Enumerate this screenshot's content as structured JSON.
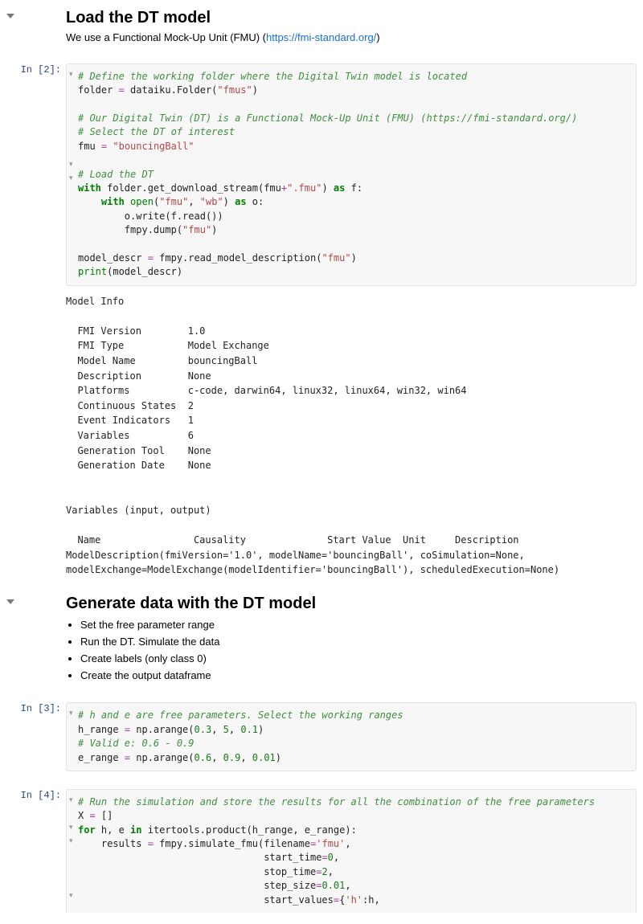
{
  "cells": {
    "md1": {
      "heading": "Load the DT model",
      "intro_pre": "We use a Functional Mock-Up Unit (FMU) (",
      "intro_link": "https://fmi-standard.org/",
      "intro_post": ")"
    },
    "code2": {
      "prompt": "In [2]:",
      "c1": "# Define the working folder where the Digital Twin model is located",
      "l2a": "folder ",
      "l2b": " dataiku.Folder(",
      "l2s": "\"fmus\"",
      "l2c": ")",
      "c3": "# Our Digital Twin (DT) is a Functional Mock-Up Unit (FMU) (https://fmi-standard.org/)",
      "c4": "# Select the DT of interest",
      "l5a": "fmu ",
      "l5s": "\"bouncingBall\"",
      "c6": "# Load the DT",
      "l7a": " folder.get_download_stream(fmu",
      "l7s": "\".fmu\"",
      "l7b": ") ",
      "l7c": " f:",
      "l8a": "(",
      "l8s1": "\"fmu\"",
      "l8b": ", ",
      "l8s2": "\"wb\"",
      "l8c": ") ",
      "l8d": " o:",
      "l9": "        o.write(f.read())",
      "l10a": "        fmpy.dump(",
      "l10s": "\"fmu\"",
      "l10b": ")",
      "l11a": "model_descr ",
      "l11b": " fmpy.read_model_description(",
      "l11s": "\"fmu\"",
      "l11c": ")",
      "l12a": "(model_descr)",
      "kw_with": "with",
      "kw_as": "as",
      "kw_open": "open",
      "kw_print": "print",
      "op_eq": "=",
      "op_plus": "+",
      "output": "Model Info\n\n  FMI Version        1.0\n  FMI Type           Model Exchange\n  Model Name         bouncingBall\n  Description        None\n  Platforms          c-code, darwin64, linux32, linux64, win32, win64\n  Continuous States  2\n  Event Indicators   1\n  Variables          6\n  Generation Tool    None\n  Generation Date    None\n\n\nVariables (input, output)\n\n  Name                Causality              Start Value  Unit     Description\nModelDescription(fmiVersion='1.0', modelName='bouncingBall', coSimulation=None, modelExchange=ModelExchange(modelIdentifier='bouncingBall'), scheduledExecution=None)"
    },
    "md2": {
      "heading": "Generate data with the DT model",
      "li1": "Set the free parameter range",
      "li2": "Run the DT. Simulate the data",
      "li3": "Create labels (only class 0)",
      "li4": "Create the output dataframe"
    },
    "code3": {
      "prompt": "In [3]:",
      "c1": "# h and e are free parameters. Select the working ranges",
      "l2a": "h_range ",
      "l2b": " np.arange(",
      "l2n1": "0.3",
      "l2c": ", ",
      "l2n2": "5",
      "l2d": ", ",
      "l2n3": "0.1",
      "l2e": ")",
      "c3": "# Valid e: 0.6 - 0.9",
      "l4a": "e_range ",
      "l4b": " np.arange(",
      "l4n1": "0.6",
      "l4c": ", ",
      "l4n2": "0.9",
      "l4d": ", ",
      "l4n3": "0.01",
      "l4e": ")",
      "op_eq": "="
    },
    "code4": {
      "prompt": "In [4]:",
      "c1": "# Run the simulation and store the results for all the combination of the free parameters",
      "l2a": "X ",
      "l2b": " []",
      "l3a": " h, e ",
      "l3b": " itertools.product(h_range, e_range):",
      "l4a": "    results ",
      "l4b": " fmpy.simulate_fmu(filename",
      "l4s": "'fmu'",
      "l4c": ",",
      "l5a": "                                start_time",
      "l5n": "0",
      "l5b": ",",
      "l6a": "                                stop_time",
      "l6n": "2",
      "l6b": ",",
      "l7a": "                                step_size",
      "l7n": "0.01",
      "l7b": ",",
      "l8a": "                                start_values",
      "l8b": "{",
      "l8s": "'h'",
      "l8c": ":h,",
      "kw_for": "for",
      "kw_in": "in",
      "op_eq": "="
    }
  }
}
